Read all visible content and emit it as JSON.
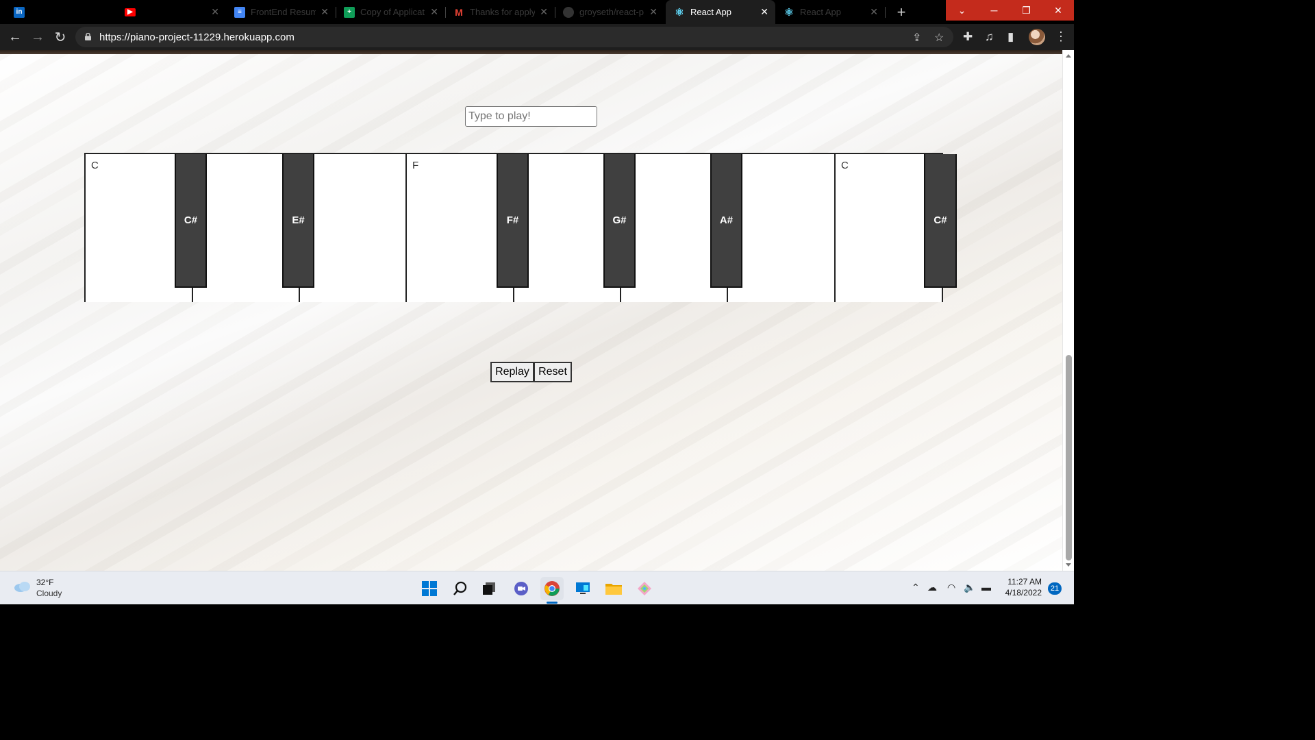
{
  "browser": {
    "tabs": [
      {
        "title": "",
        "icon": "linkedin-icon",
        "color": "#0a66c2"
      },
      {
        "title": "",
        "icon": "youtube-icon",
        "color": "#ff0000"
      },
      {
        "title": "FrontEnd Resum",
        "icon": "google-docs-icon",
        "color": "#4285f4"
      },
      {
        "title": "Copy of Applicat",
        "icon": "google-sheets-icon",
        "color": "#0f9d58"
      },
      {
        "title": "Thanks for apply",
        "icon": "gmail-icon",
        "color": "#ea4335"
      },
      {
        "title": "groyseth/react-p",
        "icon": "github-icon",
        "color": "#444444"
      },
      {
        "title": "React App",
        "icon": "react-icon",
        "color": "#61dafb",
        "active": true
      },
      {
        "title": "React App",
        "icon": "react-icon",
        "color": "#61dafb"
      }
    ],
    "url": "https://piano-project-11229.herokuapp.com"
  },
  "page": {
    "input_placeholder": "Type to play!",
    "white_keys": [
      "C",
      "",
      "",
      "F",
      "",
      "",
      "",
      "C"
    ],
    "black_keys": [
      "C#",
      "E#",
      "F#",
      "G#",
      "A#",
      "C#"
    ],
    "buttons": {
      "replay": "Replay",
      "reset": "Reset"
    }
  },
  "taskbar": {
    "weather_temp": "32°F",
    "weather_cond": "Cloudy",
    "time": "11:27 AM",
    "date": "4/18/2022",
    "notifications": "21"
  },
  "colors": {
    "accent": "#0067c0",
    "titlebar_red": "#c42b1c",
    "black_key": "#404040"
  }
}
